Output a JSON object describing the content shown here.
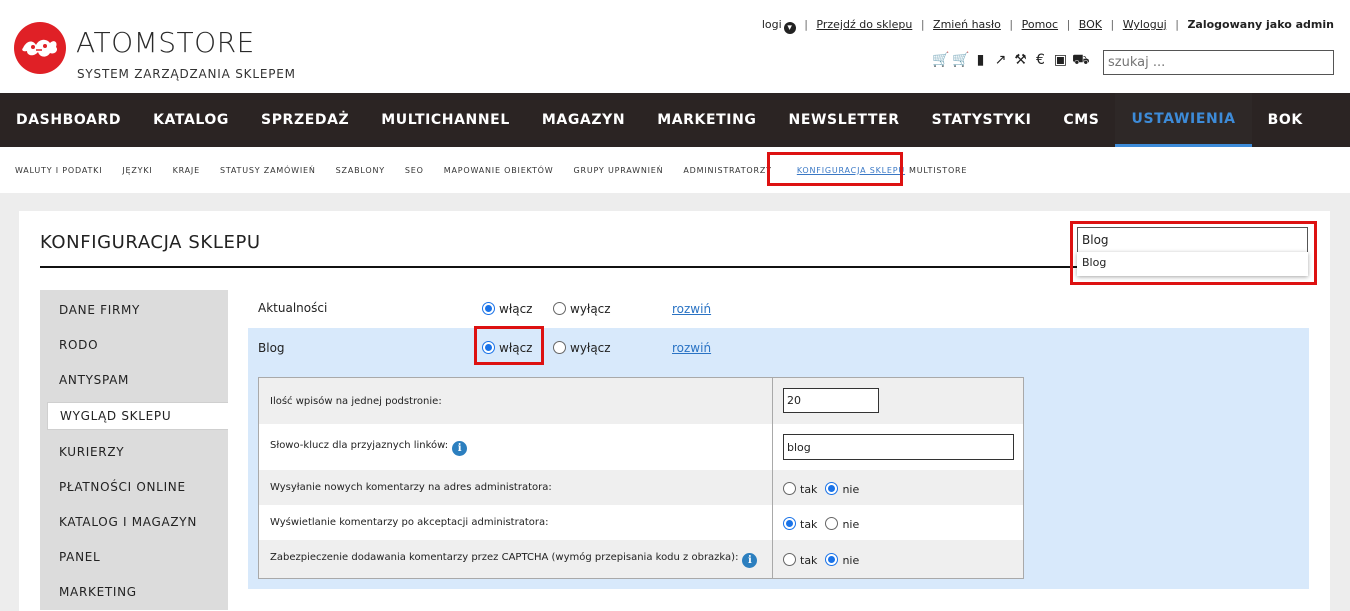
{
  "header": {
    "brand": "ATOMSTORE",
    "tagline": "SYSTEM ZARZĄDZANIA SKLEPEM",
    "links": {
      "logi": "logi",
      "store": "Przejdź do sklepu",
      "password": "Zmień hasło",
      "help": "Pomoc",
      "bok": "BOK",
      "logout": "Wyloguj",
      "logged": "Zalogowany jako admin"
    },
    "quick_icons": [
      "cart-plus-icon",
      "cart-icon",
      "document-icon",
      "share-icon",
      "gavel-icon",
      "euro-icon",
      "money-icon",
      "truck-icon"
    ],
    "search_placeholder": "szukaj ..."
  },
  "mainnav": [
    "DASHBOARD",
    "KATALOG",
    "SPRZEDAŻ",
    "MULTICHANNEL",
    "MAGAZYN",
    "MARKETING",
    "NEWSLETTER",
    "STATYSTYKI",
    "CMS",
    "USTAWIENIA",
    "BOK"
  ],
  "mainnav_active": "USTAWIENIA",
  "subnav": [
    "WALUTY I PODATKI",
    "JĘZYKI",
    "KRAJE",
    "STATUSY ZAMÓWIEŃ",
    "SZABLONY",
    "SEO",
    "MAPOWANIE OBIEKTÓW",
    "GRUPY UPRAWNIEŃ",
    "ADMINISTRATORZY",
    "KONFIGURACJA SKLEPU",
    "MULTISTORE"
  ],
  "subnav_active": "KONFIGURACJA SKLEPU",
  "page": {
    "title": "KONFIGURACJA SKLEPU",
    "search_value": "Blog",
    "search_suggestion": "Blog"
  },
  "leftmenu": [
    "DANE FIRMY",
    "RODO",
    "ANTYSPAM",
    "WYGLĄD SKLEPU",
    "KURIERZY",
    "PŁATNOŚCI ONLINE",
    "KATALOG I MAGAZYN",
    "PANEL",
    "MARKETING"
  ],
  "leftmenu_active": "WYGLĄD SKLEPU",
  "modules": [
    {
      "label": "Aktualności",
      "on": "włącz",
      "off": "wyłącz",
      "selected": "włącz",
      "expand": "rozwiń"
    },
    {
      "label": "Blog",
      "on": "włącz",
      "off": "wyłącz",
      "selected": "włącz",
      "expand": "rozwiń"
    }
  ],
  "blog_settings": {
    "posts_per_page_label": "Ilość wpisów na jednej podstronie:",
    "posts_per_page_value": "20",
    "keyword_label": "Słowo-klucz dla przyjaznych linków:",
    "keyword_value": "blog",
    "send_comments_label": "Wysyłanie nowych komentarzy na adres administratora:",
    "send_comments_selected": "nie",
    "show_after_accept_label": "Wyświetlanie komentarzy po akceptacji administratora:",
    "show_after_accept_selected": "tak",
    "captcha_label": "Zabezpieczenie dodawania komentarzy przez CAPTCHA (wymóg przepisania kodu z obrazka):",
    "captcha_selected": "nie",
    "yes": "tak",
    "no": "nie"
  },
  "colors": {
    "nav_bg": "#2b2423",
    "accent": "#3d8bd8",
    "highlight": "#dd1111",
    "band": "#d8e9fb",
    "logo": "#e02026"
  }
}
